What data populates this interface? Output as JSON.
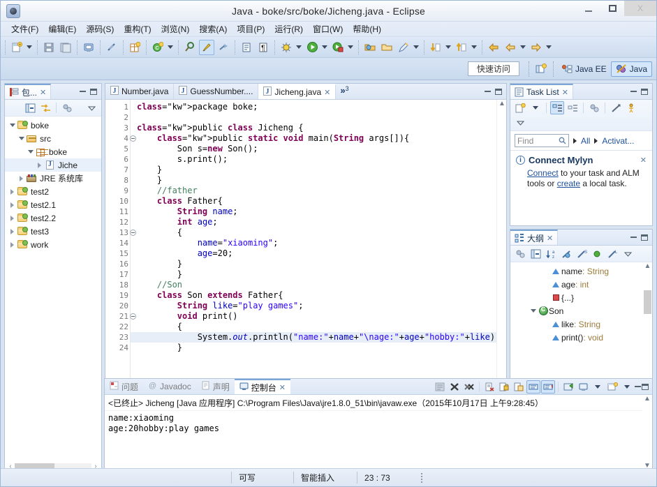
{
  "window": {
    "title": "Java - boke/src/boke/Jicheng.java - Eclipse",
    "app_icon": "eclipse-icon",
    "minimize_label": "",
    "maximize_label": "",
    "close_label": "X"
  },
  "menubar": {
    "items": [
      {
        "label": "文件(F)",
        "name": "menu-file"
      },
      {
        "label": "编辑(E)",
        "name": "menu-edit"
      },
      {
        "label": "源码(S)",
        "name": "menu-source"
      },
      {
        "label": "重构(T)",
        "name": "menu-refactor"
      },
      {
        "label": "浏览(N)",
        "name": "menu-navigate"
      },
      {
        "label": "搜索(A)",
        "name": "menu-search"
      },
      {
        "label": "项目(P)",
        "name": "menu-project"
      },
      {
        "label": "运行(R)",
        "name": "menu-run"
      },
      {
        "label": "窗口(W)",
        "name": "menu-window"
      },
      {
        "label": "帮助(H)",
        "name": "menu-help"
      }
    ]
  },
  "quick_access": {
    "placeholder": "快速访问",
    "perspectives": [
      {
        "label": "Java EE",
        "active": false
      },
      {
        "label": "Java",
        "active": true
      }
    ]
  },
  "package_explorer": {
    "tab_label": "包...",
    "tree": [
      {
        "label": "boke",
        "indent": 0,
        "twist": "open",
        "icon": "project-folder-icon"
      },
      {
        "label": "src",
        "indent": 1,
        "twist": "open",
        "icon": "source-folder-icon"
      },
      {
        "label": "boke",
        "indent": 2,
        "twist": "open",
        "icon": "package-icon"
      },
      {
        "label": "Jiche",
        "indent": 3,
        "twist": "closed",
        "icon": "java-file-icon",
        "selected": true
      },
      {
        "label": "JRE 系统库",
        "indent": 1,
        "twist": "closed",
        "icon": "jre-library-icon"
      },
      {
        "label": "test2",
        "indent": 0,
        "twist": "closed",
        "icon": "project-folder-icon"
      },
      {
        "label": "test2.1",
        "indent": 0,
        "twist": "closed",
        "icon": "project-folder-icon"
      },
      {
        "label": "test2.2",
        "indent": 0,
        "twist": "closed",
        "icon": "project-folder-icon"
      },
      {
        "label": "test3",
        "indent": 0,
        "twist": "closed",
        "icon": "project-folder-icon"
      },
      {
        "label": "work",
        "indent": 0,
        "twist": "closed",
        "icon": "project-folder-icon"
      }
    ]
  },
  "editor": {
    "tabs": [
      {
        "label": "Number.java",
        "active": false,
        "closable": false
      },
      {
        "label": "GuessNumber....",
        "active": false,
        "closable": false
      },
      {
        "label": "Jicheng.java",
        "active": true,
        "closable": true
      }
    ],
    "more_tabs": "»",
    "more_count": "3",
    "highlighted_line": 23,
    "lines": [
      {
        "n": 1,
        "fold": false,
        "text": "package boke;"
      },
      {
        "n": 2,
        "fold": false,
        "text": ""
      },
      {
        "n": 3,
        "fold": false,
        "text": "public class Jicheng {"
      },
      {
        "n": 4,
        "fold": true,
        "text": "    public static void main(String args[]){"
      },
      {
        "n": 5,
        "fold": false,
        "text": "        Son s=new Son();"
      },
      {
        "n": 6,
        "fold": false,
        "text": "        s.print();"
      },
      {
        "n": 7,
        "fold": false,
        "text": "    }"
      },
      {
        "n": 8,
        "fold": false,
        "text": "    }"
      },
      {
        "n": 9,
        "fold": false,
        "text": "    //father"
      },
      {
        "n": 10,
        "fold": false,
        "text": "    class Father{"
      },
      {
        "n": 11,
        "fold": false,
        "text": "        String name;"
      },
      {
        "n": 12,
        "fold": false,
        "text": "        int age;"
      },
      {
        "n": 13,
        "fold": true,
        "text": "        {"
      },
      {
        "n": 14,
        "fold": false,
        "text": "            name=\"xiaoming\";"
      },
      {
        "n": 15,
        "fold": false,
        "text": "            age=20;"
      },
      {
        "n": 16,
        "fold": false,
        "text": "        }"
      },
      {
        "n": 17,
        "fold": false,
        "text": "        }"
      },
      {
        "n": 18,
        "fold": false,
        "text": "    //Son"
      },
      {
        "n": 19,
        "fold": false,
        "text": "    class Son extends Father{"
      },
      {
        "n": 20,
        "fold": false,
        "text": "        String like=\"play games\";"
      },
      {
        "n": 21,
        "fold": true,
        "text": "        void print()"
      },
      {
        "n": 22,
        "fold": false,
        "text": "        {"
      },
      {
        "n": 23,
        "fold": false,
        "text": "            System.out.println(\"name:\"+name+\"\\nage:\"+age+\"hobby:\"+like);"
      },
      {
        "n": 24,
        "fold": false,
        "text": "        }"
      }
    ]
  },
  "task_list": {
    "tab_label": "Task List",
    "find_placeholder": "Find",
    "filter_all": "All",
    "filter_activate": "Activat...",
    "notice": {
      "title": "Connect Mylyn",
      "link1": "Connect",
      "text1": " to your task and ALM tools or ",
      "link2": "create",
      "text2": " a local task."
    }
  },
  "outline": {
    "tab_label": "大纲",
    "items": [
      {
        "label": "name",
        "type": " : String",
        "icon": "field-icon",
        "indent": 2,
        "twist": "none"
      },
      {
        "label": "age",
        "type": " : int",
        "icon": "field-icon",
        "indent": 2,
        "twist": "none"
      },
      {
        "label": "{...}",
        "type": "",
        "icon": "initializer-icon",
        "indent": 2,
        "twist": "none"
      },
      {
        "label": "Son",
        "type": "",
        "icon": "class-icon",
        "indent": 1,
        "twist": "open"
      },
      {
        "label": "like",
        "type": " : String",
        "icon": "field-icon",
        "indent": 2,
        "twist": "none"
      },
      {
        "label": "print()",
        "type": " : void",
        "icon": "method-icon",
        "indent": 2,
        "twist": "none"
      }
    ]
  },
  "console": {
    "tabs": [
      {
        "label": "问题",
        "active": false,
        "icon": "problems-icon"
      },
      {
        "label": "Javadoc",
        "active": false,
        "icon": "javadoc-icon"
      },
      {
        "label": "声明",
        "active": false,
        "icon": "declaration-icon"
      },
      {
        "label": "控制台",
        "active": true,
        "icon": "console-icon"
      }
    ],
    "header": "<已终止> Jicheng [Java 应用程序] C:\\Program Files\\Java\\jre1.8.0_51\\bin\\javaw.exe（2015年10月17日 上午9:28:45）",
    "output": "name:xiaoming\nage:20hobby:play games"
  },
  "statusbar": {
    "writable": "可写",
    "insert_mode": "智能插入",
    "position": "23 : 73"
  },
  "colors": {
    "accent": "#7aa5d6",
    "keyword": "#7f0055",
    "string": "#2a00ff",
    "comment": "#3f7f5f",
    "field": "#0000c0",
    "link": "#1c4f9c",
    "chrome": "#d9e4f3"
  }
}
